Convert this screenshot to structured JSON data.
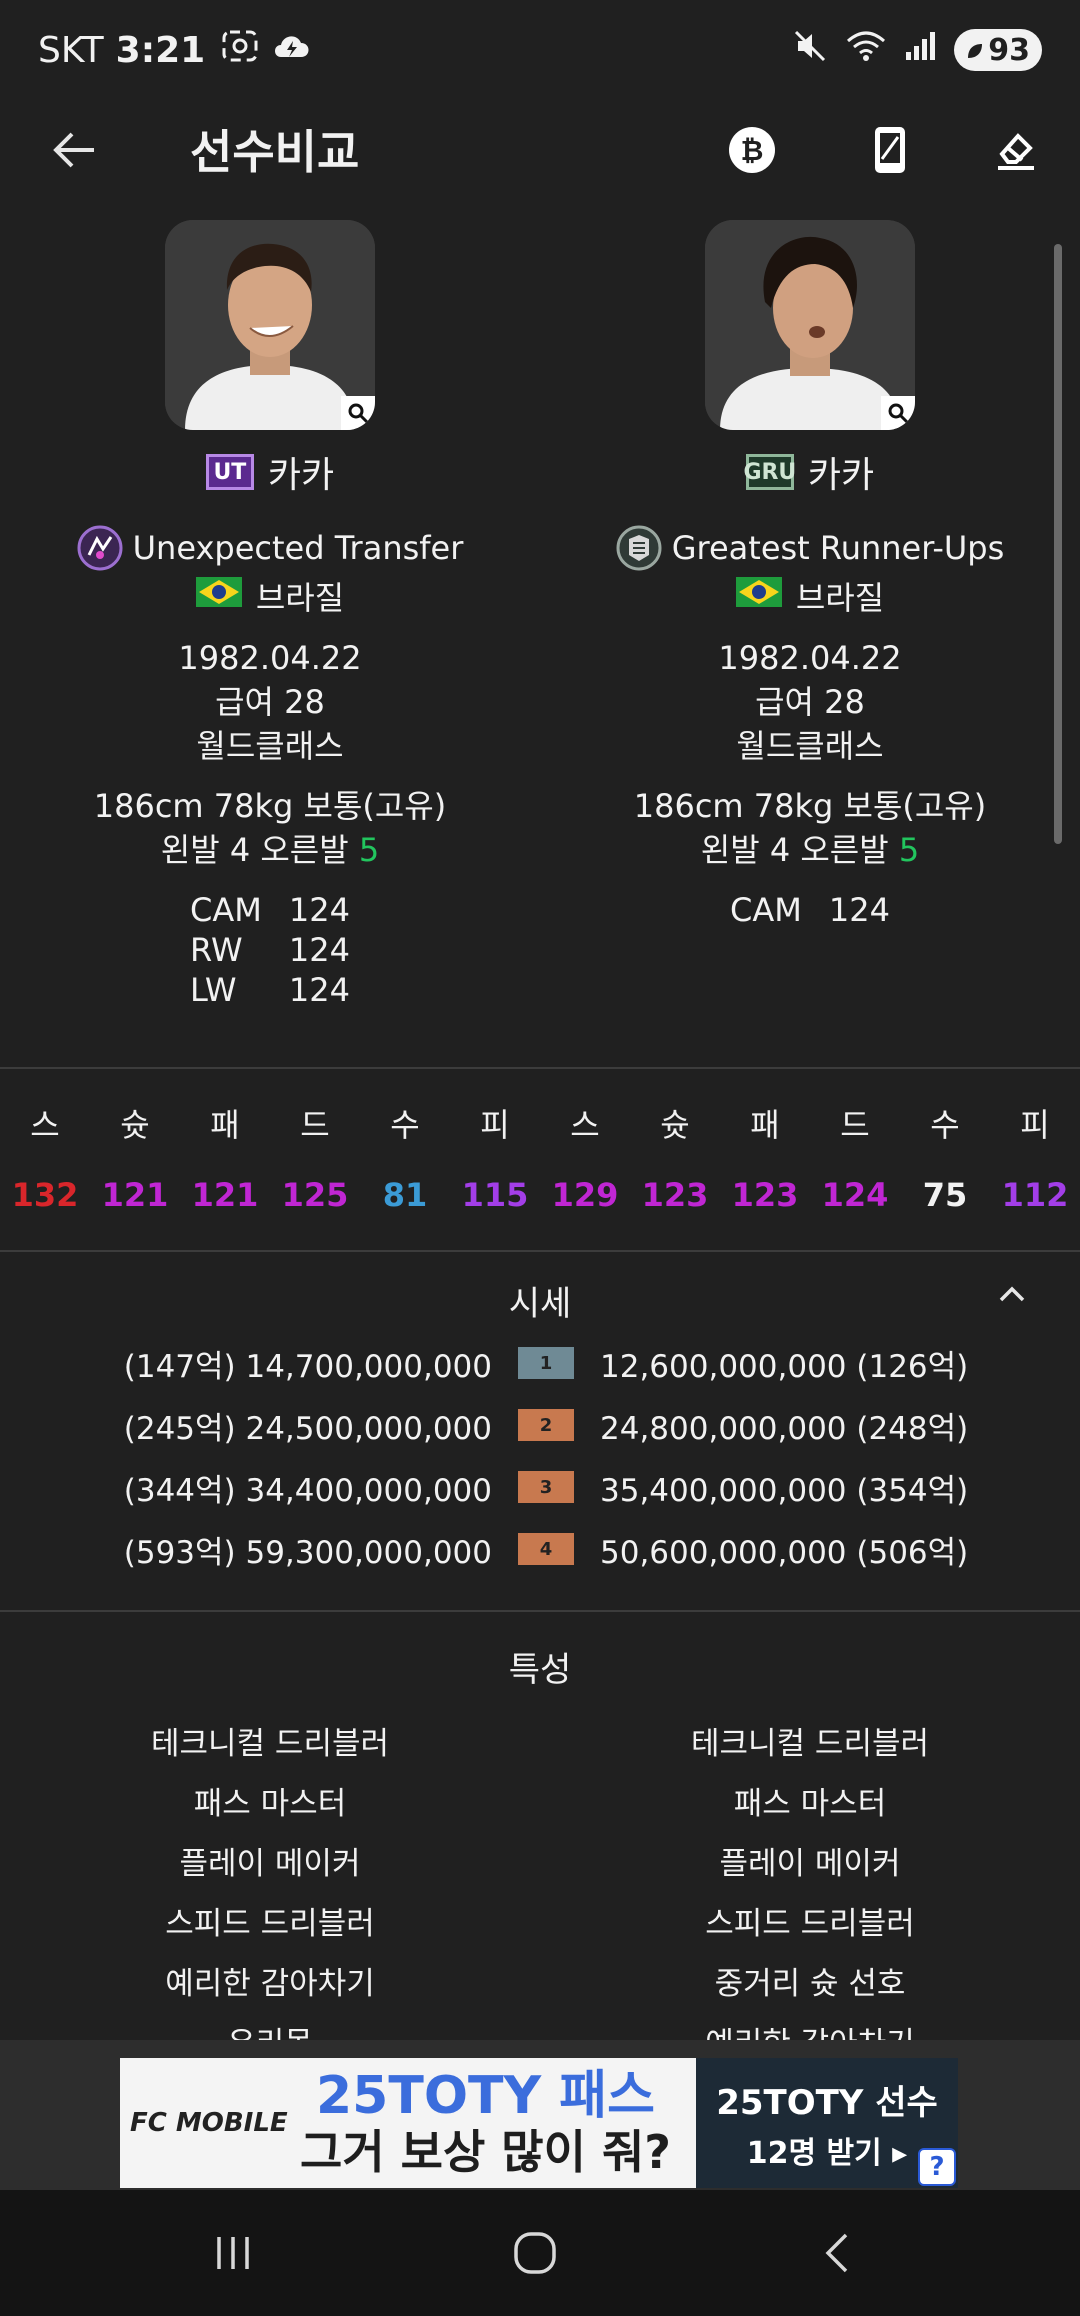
{
  "status_bar": {
    "carrier": "SKT",
    "time": "3:21",
    "battery": "93"
  },
  "header": {
    "title": "선수비교"
  },
  "players": [
    {
      "season_badge": "UT",
      "name": "카카",
      "season": "Unexpected Transfer",
      "nation": "브라질",
      "birth": "1982.04.22",
      "salary": "급여 28",
      "tier": "월드클래스",
      "body": "186cm 78kg 보통(고유)",
      "foot_prefix": "왼발 4 오른발 ",
      "foot_strong": "5",
      "positions": [
        {
          "pos": "CAM",
          "ovr": "124"
        },
        {
          "pos": "RW",
          "ovr": "124"
        },
        {
          "pos": "LW",
          "ovr": "124"
        }
      ],
      "stats": [
        "132",
        "121",
        "121",
        "125",
        "81",
        "115"
      ],
      "prices": [
        "(147억) 14,700,000,000",
        "(245억) 24,500,000,000",
        "(344억) 34,400,000,000",
        "(593억) 59,300,000,000"
      ],
      "traits": [
        "테크니컬 드리블러",
        "패스 마스터",
        "플레이 메이커",
        "스피드 드리블러",
        "예리한 감아차기",
        "유리몸"
      ]
    },
    {
      "season_badge": "GRU",
      "name": "카카",
      "season": "Greatest Runner-Ups",
      "nation": "브라질",
      "birth": "1982.04.22",
      "salary": "급여 28",
      "tier": "월드클래스",
      "body": "186cm 78kg 보통(고유)",
      "foot_prefix": "왼발 4 오른발 ",
      "foot_strong": "5",
      "positions": [
        {
          "pos": "CAM",
          "ovr": "124"
        }
      ],
      "stats": [
        "129",
        "123",
        "123",
        "124",
        "75",
        "112"
      ],
      "prices": [
        "12,600,000,000 (126억)",
        "24,800,000,000 (248억)",
        "35,400,000,000 (354억)",
        "50,600,000,000 (506억)"
      ],
      "traits": [
        "테크니컬 드리블러",
        "패스 마스터",
        "플레이 메이커",
        "스피드 드리블러",
        "중거리 슛 선호",
        "예리한 감아차기"
      ]
    }
  ],
  "stat_labels": [
    "스",
    "슛",
    "패",
    "드",
    "수",
    "피"
  ],
  "stat_colors": {
    "left": [
      "#d9262b",
      "#c026d3",
      "#c026d3",
      "#c026d3",
      "#3b9bd6",
      "#a33ee8"
    ],
    "right": [
      "#c026d3",
      "#c026d3",
      "#c026d3",
      "#c026d3",
      "#f2f2f2",
      "#a33ee8"
    ]
  },
  "price_section": {
    "title": "시세",
    "grades": [
      "1",
      "2",
      "3",
      "4"
    ],
    "grade_colors": [
      "#6f8a95",
      "#c8794f",
      "#c8794f",
      "#c8794f"
    ]
  },
  "traits_section": {
    "title": "특성"
  },
  "ad": {
    "logo": "FC MOBILE",
    "line1": "25TOTY 패스",
    "line2": "그거 보상 많이 줘?",
    "right1": "25TOTY 선수",
    "right2": "12명 받기 ▸",
    "help": "?"
  },
  "icons": {
    "back": "arrow-left-icon",
    "coin": "bitcoin-icon",
    "phone": "phone-icon",
    "eraser": "eraser-icon"
  }
}
